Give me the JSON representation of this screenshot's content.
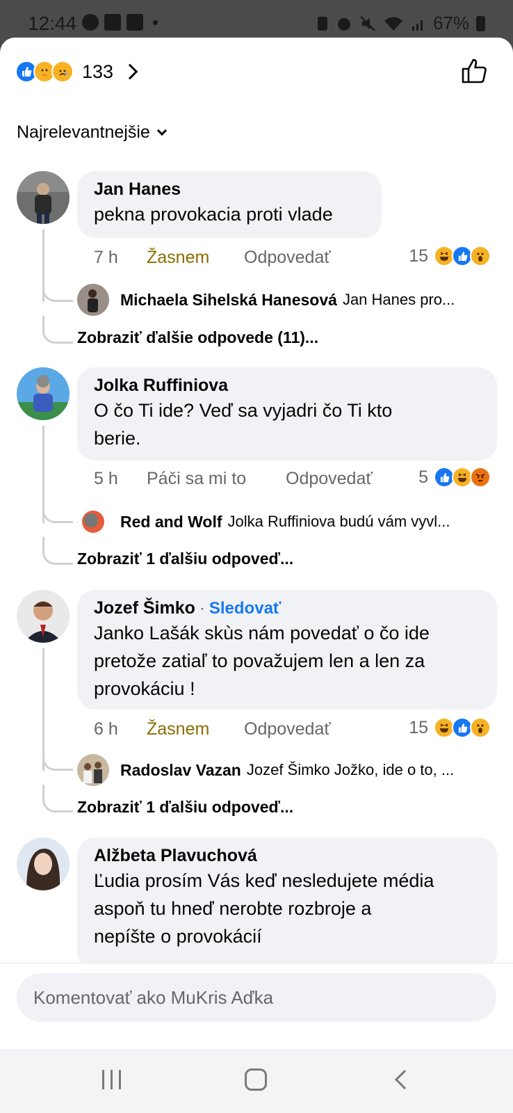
{
  "status_bar": {
    "time": "12:44",
    "battery": "67%"
  },
  "header": {
    "reaction_count": "133",
    "reactions": [
      "like",
      "care",
      "sad"
    ]
  },
  "sort": {
    "label": "Najrelevantnejšie"
  },
  "comments": [
    {
      "author": "Jan Hanes",
      "text": "pekna provokacia proti vlade",
      "time": "7 h",
      "react_label": "Žasnem",
      "reply_label": "Odpovedať",
      "reaction_count": "15",
      "reactions": [
        "haha",
        "like",
        "wow"
      ],
      "reply": {
        "author": "Michaela Sihelská Hanesová",
        "snippet": "Jan Hanes pro..."
      },
      "more_replies": "Zobraziť ďalšie odpovede (11)..."
    },
    {
      "author": "Jolka Ruffiniova",
      "text_lines": [
        "O čo Ti ide? Veď sa vyjadri čo Ti kto",
        "berie."
      ],
      "time": "5 h",
      "react_label": "Páči sa mi to",
      "reply_label": "Odpovedať",
      "reaction_count": "5",
      "reactions": [
        "like",
        "haha",
        "angry"
      ],
      "reply": {
        "author": "Red and Wolf",
        "snippet": "Jolka Ruffiniova budú vám vyvl..."
      },
      "more_replies": "Zobraziť 1 ďalšiu odpoveď..."
    },
    {
      "author": "Jozef Šimko",
      "follow_label": "Sledovať",
      "text_lines": [
        "Janko Lašák skùs nám povedať o čo ide",
        "pretože zatiaľ to považujem len a len za",
        "provokáciu !"
      ],
      "time": "6 h",
      "react_label": "Žasnem",
      "reply_label": "Odpovedať",
      "reaction_count": "15",
      "reactions": [
        "haha",
        "like",
        "wow"
      ],
      "reply": {
        "author": "Radoslav Vazan",
        "snippet": "Jozef Šimko Jožko, ide o to, ..."
      },
      "more_replies": "Zobraziť 1 ďalšiu odpoveď..."
    },
    {
      "author": "Alžbeta Plavuchová",
      "text_lines": [
        "Ľudia prosím Vás keď nesledujete média",
        "aspoň tu hneď nerobte rozbroje a",
        "nepíšte o provokácií"
      ]
    }
  ],
  "composer": {
    "placeholder": "Komentovať ako MuKris Aďka"
  }
}
